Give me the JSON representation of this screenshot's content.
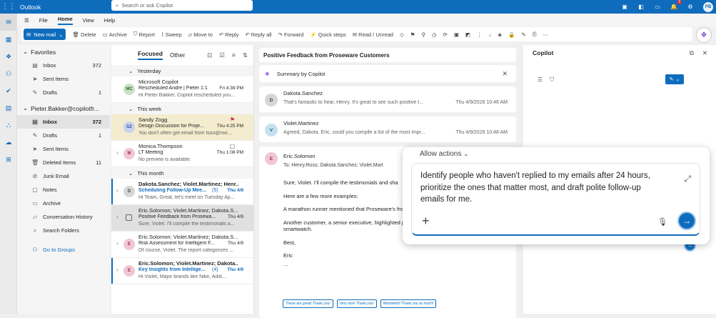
{
  "app": {
    "name": "Outlook",
    "search_placeholder": "Search or ask Copilot",
    "notif_count": "3",
    "user_initials": "PB"
  },
  "menu": [
    "File",
    "Home",
    "View",
    "Help"
  ],
  "ribbon": {
    "new_mail": "New mail",
    "delete": "Delete",
    "archive": "Archive",
    "report": "Report",
    "sweep": "Sweep",
    "move_to": "Move to",
    "reply": "Reply",
    "reply_all": "Reply all",
    "forward": "Forward",
    "quick_steps": "Quick steps",
    "read_unread": "Read / Unread"
  },
  "folders": {
    "favorites_header": "Favorites",
    "favorites": [
      {
        "label": "Inbox",
        "count": "372"
      },
      {
        "label": "Sent Items",
        "count": ""
      },
      {
        "label": "Drafts",
        "count": "1"
      }
    ],
    "account_header": "Pieter.Bakker@copilotfr...",
    "account": [
      {
        "label": "Inbox",
        "count": "372"
      },
      {
        "label": "Drafts",
        "count": "1"
      },
      {
        "label": "Sent Items",
        "count": ""
      },
      {
        "label": "Deleted Items",
        "count": "11"
      },
      {
        "label": "Junk Email",
        "count": ""
      },
      {
        "label": "Notes",
        "count": ""
      },
      {
        "label": "Archive",
        "count": ""
      },
      {
        "label": "Conversation History",
        "count": ""
      },
      {
        "label": "Search Folders",
        "count": ""
      }
    ],
    "groups_link": "Go to Groups"
  },
  "list": {
    "tab_focused": "Focused",
    "tab_other": "Other",
    "group_yesterday": "Yesterday",
    "group_week": "This week",
    "group_month": "This month",
    "mails": [
      {
        "initials": "MC",
        "sender": "Microsoft Copilot",
        "subject": "Rescheduled Andre | Pieter 1:1",
        "time": "Fri 4:39 PM",
        "preview": "Hi Pieter Bakker, Copilot rescheduled you..."
      },
      {
        "initials": "SZ",
        "sender": "Sandy Zogg",
        "subject": "Design Discussion for Proje...",
        "time": "Thu 4:25 PM",
        "preview": "You don't often get email from tszo@mic..."
      },
      {
        "initials": "M",
        "sender": "Monica.Thompson",
        "subject": "LT Meeting",
        "time": "Thu 1:08 PM",
        "preview": "No preview is available."
      },
      {
        "initials": "D",
        "sender": "Dakota.Sanchez; Violet.Martinez; Henr...",
        "subject": "Scheduling Follow-Up Mee...",
        "count": "(5)",
        "time": "Thu 4/9",
        "preview": "Hi Team, Great, let's meet on Tuesday Ap..."
      },
      {
        "initials": "",
        "sender": "Eric.Solomon; Violet.Martinez; Dakota.S...",
        "subject": "Positive Feedback from Prosewa...",
        "time": "Thu 4/9",
        "preview": "Sure, Violet. I'll compile the testimonials a..."
      },
      {
        "initials": "E",
        "sender": "Eric.Solomon; Violet.Martinez; Dakota.S...",
        "subject": "Risk Assessment for Intelligent F...",
        "time": "Thu 4/9",
        "preview": "Of course, Violet. The report categorizes ..."
      },
      {
        "initials": "E",
        "sender": "Eric.Solomon; Violet.Martinez; Dakota...",
        "subject": "Key Insights from Intellige...",
        "count": "(4)",
        "time": "Thu 4/9",
        "preview": "Hi Violet, Major brands like Nike, Adid..."
      }
    ]
  },
  "reading": {
    "subject": "Positive Feedback from Proseware Customers",
    "summary_label": "Summary by Copilot",
    "messages": [
      {
        "initials": "D",
        "sender": "Dakota.Sanchez",
        "preview": "That's fantastic to hear, Henry. It's great to see such positive t...",
        "time": "Thu 4/9/2026 10:46 AM"
      },
      {
        "initials": "V",
        "sender": "Violet.Martinez",
        "preview": "Agreed, Dakota. Eric, could you compile a list of the most impr...",
        "time": "Thu 4/9/2026 10:48 AM"
      }
    ],
    "full": {
      "initials": "E",
      "sender": "Eric.Solomon",
      "to": "To:  Henry.Ross;  Dakota.Sanchez;  Violet.Mart",
      "body": [
        "Sure, Violet. I'll compile the testimonials and sha",
        "Here are a few more examples:",
        "A marathon runner mentioned that Proseware's from a knee issue and optimize their training.",
        "Another customer, a senior executive, highlighted productivity insights provided by Proseware's smartwatch.",
        "Best,",
        "Eric",
        "..."
      ],
      "replies": [
        "These are great! Thank you!",
        "Very nice! Thank you!",
        "Wonderful! Thank you so much!"
      ]
    }
  },
  "copilot": {
    "title": "Copilot",
    "allow_actions": "Allow actions",
    "prompt": "Identify people who haven't replied to my emails after 24 hours, prioritize the ones that matter most, and draft polite follow-up emails for me."
  },
  "colors": {
    "brand": "#0f6cbd"
  }
}
